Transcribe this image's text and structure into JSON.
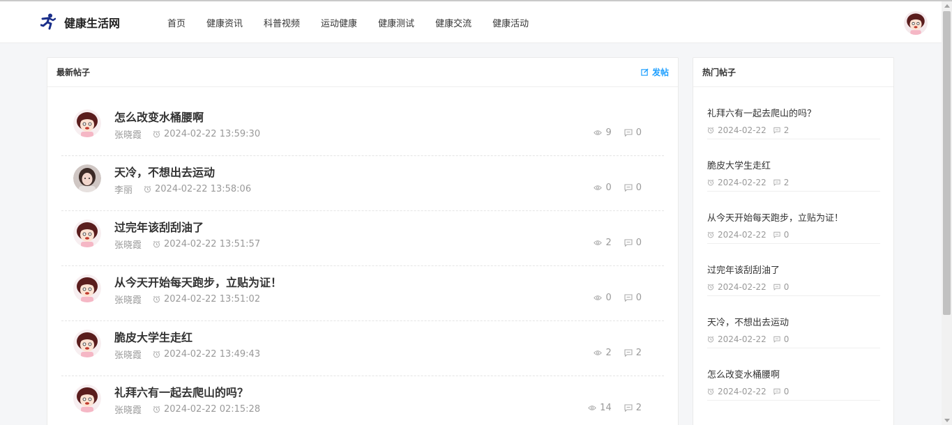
{
  "brand": {
    "name": "健康生活网"
  },
  "nav": [
    "首页",
    "健康资讯",
    "科普视频",
    "运动健康",
    "健康测试",
    "健康交流",
    "健康活动"
  ],
  "latest": {
    "title": "最新帖子",
    "post_button": "发帖",
    "posts": [
      {
        "title": "怎么改变水桶腰啊",
        "author": "张晓霞",
        "time": "2024-02-22 13:59:30",
        "views": "9",
        "comments": "0",
        "avatar": "cartoon-girl"
      },
      {
        "title": "天冷，不想出去运动",
        "author": "李丽",
        "time": "2024-02-22 13:58:06",
        "views": "0",
        "comments": "0",
        "avatar": "photo-girl"
      },
      {
        "title": "过完年该刮刮油了",
        "author": "张晓霞",
        "time": "2024-02-22 13:51:57",
        "views": "2",
        "comments": "0",
        "avatar": "cartoon-girl"
      },
      {
        "title": "从今天开始每天跑步，立贴为证！",
        "author": "张晓霞",
        "time": "2024-02-22 13:51:02",
        "views": "0",
        "comments": "0",
        "avatar": "cartoon-girl"
      },
      {
        "title": "脆皮大学生走红",
        "author": "张晓霞",
        "time": "2024-02-22 13:49:43",
        "views": "2",
        "comments": "2",
        "avatar": "cartoon-girl"
      },
      {
        "title": "礼拜六有一起去爬山的吗？",
        "author": "张晓霞",
        "time": "2024-02-22 02:15:28",
        "views": "14",
        "comments": "2",
        "avatar": "cartoon-girl"
      }
    ]
  },
  "hot": {
    "title": "热门帖子",
    "posts": [
      {
        "title": "礼拜六有一起去爬山的吗？",
        "date": "2024-02-22",
        "comments": "2"
      },
      {
        "title": "脆皮大学生走红",
        "date": "2024-02-22",
        "comments": "2"
      },
      {
        "title": "从今天开始每天跑步，立贴为证！",
        "date": "2024-02-22",
        "comments": "0"
      },
      {
        "title": "过完年该刮刮油了",
        "date": "2024-02-22",
        "comments": "0"
      },
      {
        "title": "天冷，不想出去运动",
        "date": "2024-02-22",
        "comments": "0"
      },
      {
        "title": "怎么改变水桶腰啊",
        "date": "2024-02-22",
        "comments": "0"
      }
    ]
  },
  "colors": {
    "accent": "#1e9fff",
    "meta": "#999999",
    "logo": "#1a2f8a"
  },
  "icons": {
    "logo": "runner-icon",
    "time": "alarm-clock-icon",
    "views": "eye-icon",
    "comments": "comment-icon",
    "post": "edit-icon"
  }
}
